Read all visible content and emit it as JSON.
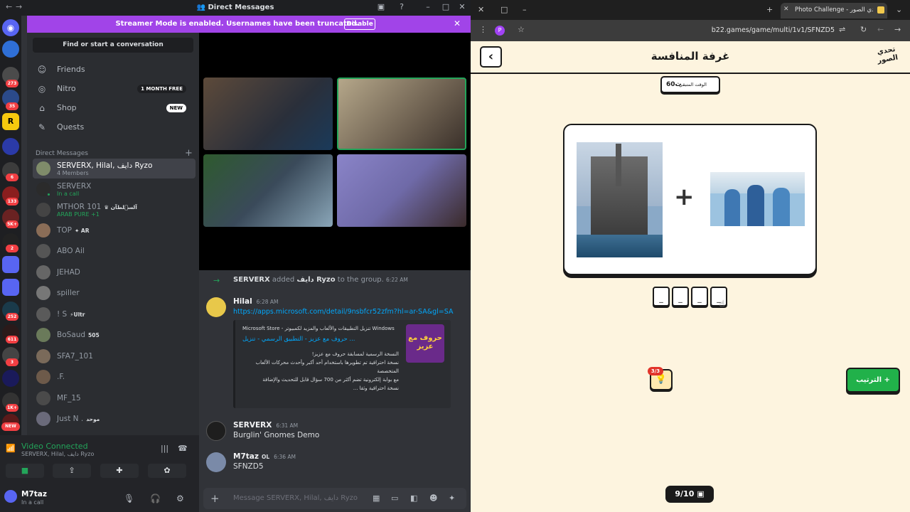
{
  "window": {
    "title": "Direct Messages"
  },
  "streamer_banner": {
    "text": "Streamer Mode is enabled. Usernames have been truncated.",
    "button": "Disable"
  },
  "guild_badges": [
    "273",
    "35",
    "6",
    "133",
    "5K+",
    "2",
    "252",
    "611",
    "3",
    "1K+",
    "NEW"
  ],
  "search": {
    "label": "Find or start a conversation"
  },
  "nav": {
    "friends": "Friends",
    "nitro": "Nitro",
    "nitro_pill": "1 MONTH FREE",
    "shop": "Shop",
    "shop_pill": "NEW",
    "quests": "Quests"
  },
  "dm_header": "Direct Messages",
  "dms": [
    {
      "name": "SERVERX, Hilal, دايف Ryzo",
      "sub": "4 Members",
      "color": "#7f8c6a"
    },
    {
      "name": "SERVERX",
      "sub": "In a call",
      "color": "#2b2b2b"
    },
    {
      "name": "MTHOR 101",
      "tag": "♛ آلسؔلطآن",
      "sub": "ARAB PURE +1",
      "color": "#444"
    },
    {
      "name": "TOP",
      "tag": "✦ AR",
      "sub": "",
      "color": "#8a6d57"
    },
    {
      "name": "ABO Ail",
      "tag": "",
      "sub": "",
      "color": "#555"
    },
    {
      "name": "JEHAD",
      "tag": "",
      "sub": "",
      "color": "#666"
    },
    {
      "name": "spiller",
      "tag": "",
      "sub": "",
      "color": "#777"
    },
    {
      "name": "! S",
      "tag": "⚡Ultr",
      "sub": "",
      "color": "#5a5a5a"
    },
    {
      "name": "BoSaud",
      "tag": "505",
      "sub": "",
      "color": "#6a7a5a"
    },
    {
      "name": "SFA7_101",
      "tag": "",
      "sub": "",
      "color": "#7a6a5a"
    },
    {
      "name": ".F.",
      "tag": "",
      "sub": "",
      "color": "#6d5a4a"
    },
    {
      "name": "MF_15",
      "tag": "",
      "sub": "",
      "color": "#4a4a4a"
    },
    {
      "name": "Just N .",
      "tag": "موحد",
      "sub": "",
      "color": "#6a6a7a"
    }
  ],
  "voice": {
    "status": "Video Connected",
    "sub": "SERVERX, Hilal, دايف Ryzo"
  },
  "user": {
    "name": "M7taz",
    "status": "In a call"
  },
  "chat": {
    "system": {
      "actor": "SERVERX",
      "text": "added",
      "target": "دايف Ryzo",
      "rest": "to the group.",
      "time": "6:22 AM"
    },
    "hilal": {
      "author": "Hilal",
      "time": "6:28 AM",
      "link": "https://apps.microsoft.com/detail/9nsbfcr52zfm?hl=ar-SA&gl=SA",
      "embed_provider": "Microsoft Store - تنزيل التطبيقات والألعاب والمزيد لكمبيوتر Windows",
      "embed_title": "حروف مع عزيز - التطبيق الرسمي - تنزيل ...",
      "embed_desc": [
        "النسخة الرسمية لمسابقة حروف مع عزيز!",
        "نسخة احترافية تم تطويرها باستخدام أحد أكبر وأحدث محركات الألعاب المتخصصة",
        "مع بوابة إلكترونية تضم أكثر من 700 سؤال قابل للتحديث والإضافة",
        "نسخة احترافية وثقا ..."
      ],
      "embed_thumb_text": "حروف مع عزيز"
    },
    "serverx": {
      "author": "SERVERX",
      "time": "6:31 AM",
      "text": "Burglin' Gnomes Demo"
    },
    "m7taz": {
      "author": "M7taz",
      "tag": "OL",
      "time": "6:36 AM",
      "text": "SFNZD5"
    },
    "placeholder": "Message SERVERX, Hilal, دايف Ryzo"
  },
  "browser": {
    "tab_title": "Photo Challenge - تحدي الصور",
    "url": "b22.games/game/multi/1v1/SFNZD5",
    "profile_letter": "P"
  },
  "game": {
    "title": "غرفة المنافسة",
    "logo": "تحدي الصور",
    "timer_label": "الوقت المتبقي",
    "timer_value": "60ث",
    "plus": "+",
    "slots": [
      "_",
      "_",
      "_",
      "_"
    ],
    "hint_count": "3/3",
    "arrange_label": "الترتيب +",
    "progress": "9/10"
  },
  "colors": {
    "accent": "#5865f2",
    "streamer": "#a144e8",
    "online": "#23a55a",
    "game_green": "#21b14a",
    "game_bg": "#fdf4df"
  },
  "icons": [
    "discord-icon",
    "friends-icon",
    "nitro-icon",
    "shop-icon",
    "quests-icon",
    "signal-icon",
    "hangup-icon",
    "camera-icon",
    "screenshare-icon",
    "activity-icon",
    "soundboard-icon",
    "mic-icon",
    "headphones-icon",
    "settings-icon",
    "back-icon",
    "star-icon",
    "reload-icon",
    "lightbulb-icon",
    "image-icon"
  ]
}
